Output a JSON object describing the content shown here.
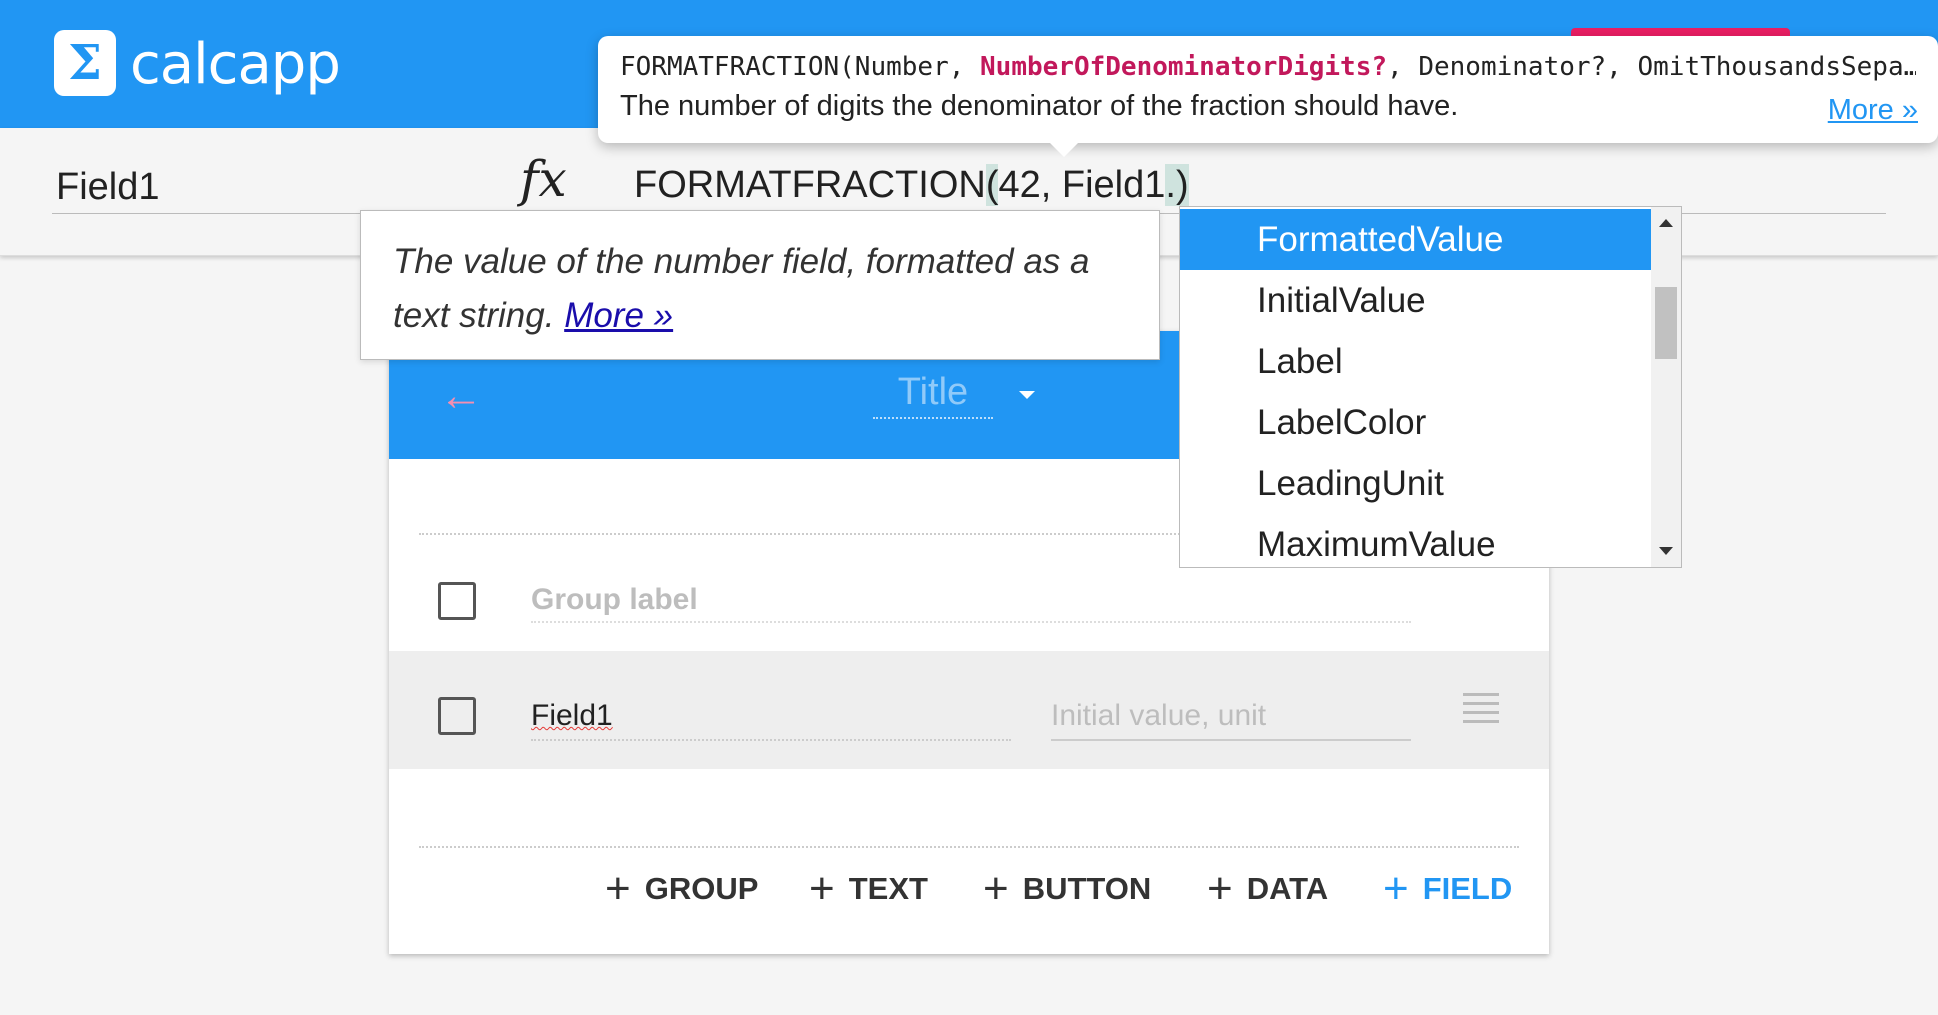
{
  "header": {
    "logo_symbol": "Σ",
    "app_name": "calcapp"
  },
  "formula_bar": {
    "field_selector": "Field1",
    "fx_label": "fx",
    "formula": {
      "function_name": "FORMATFRACTION",
      "open_paren": "(",
      "args_text": "42, Field1",
      "cursor_text": ".",
      "close_paren": ")"
    }
  },
  "signature_tooltip": {
    "prefix": "FORMATFRACTION(Number, ",
    "current_param": "NumberOfDenominatorDigits?",
    "suffix": ", Denominator?, OmitThousandsSepa…",
    "description": "The number of digits the denominator of the fraction should have.",
    "more_link": "More »"
  },
  "value_tooltip": {
    "line1": "The value of the number field, formatted as a",
    "line2": "text string.",
    "more_link": "More »"
  },
  "autocomplete": {
    "items": [
      {
        "label": "FormattedValue",
        "selected": true
      },
      {
        "label": "InitialValue",
        "selected": false
      },
      {
        "label": "Label",
        "selected": false
      },
      {
        "label": "LabelColor",
        "selected": false
      },
      {
        "label": "LeadingUnit",
        "selected": false
      },
      {
        "label": "MaximumValue",
        "selected": false
      }
    ]
  },
  "card": {
    "back_icon": "arrow-left-icon",
    "title_placeholder": "Title",
    "group_label_placeholder": "Group label",
    "field_name": "Field1",
    "initial_value_placeholder": "Initial value, unit",
    "add_buttons": [
      {
        "label": "GROUP"
      },
      {
        "label": "TEXT"
      },
      {
        "label": "BUTTON"
      },
      {
        "label": "DATA"
      },
      {
        "label": "FIELD"
      }
    ]
  },
  "colors": {
    "primary": "#2196f3",
    "accent": "#e91e63",
    "param_highlight": "#c2185b"
  }
}
